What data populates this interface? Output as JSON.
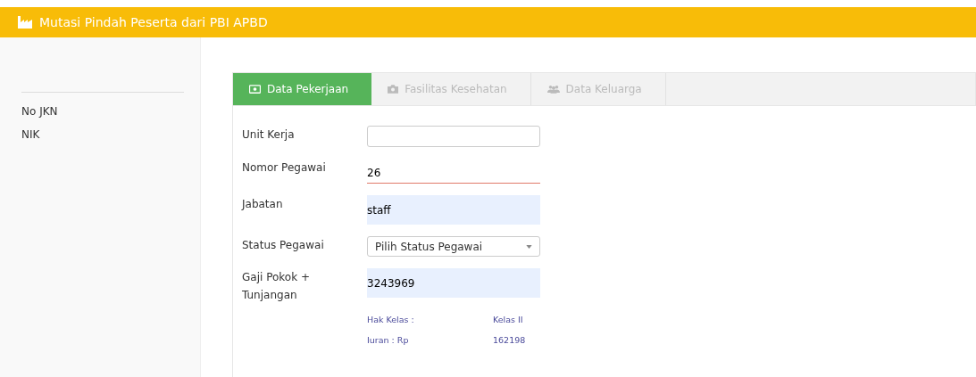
{
  "header": {
    "title": "Mutasi Pindah Peserta dari PBI APBD"
  },
  "sidebar": {
    "fields": [
      {
        "label": "No JKN"
      },
      {
        "label": "NIK"
      }
    ]
  },
  "steps": [
    {
      "label": "Data Pekerjaan",
      "selected": true
    },
    {
      "label": "Fasilitas Kesehatan",
      "selected": false
    },
    {
      "label": "Data Keluarga",
      "selected": false
    }
  ],
  "form": [
    {
      "label": "Unit Kerja",
      "kind": "input",
      "focused": false,
      "autofilled": false
    },
    {
      "label": "Nomor Pegawai",
      "kind": "input",
      "value": "26",
      "focused": true,
      "autofilled": false
    },
    {
      "label": "Jabatan",
      "kind": "input",
      "value": "staff",
      "focused": false,
      "autofilled": true
    },
    {
      "label": "Status Pegawai",
      "kind": "select",
      "value": "Pilih Status Pegawai"
    },
    {
      "label": "Gaji Pokok + Tunjangan",
      "kind": "input",
      "value": "3243969",
      "focused": false,
      "autofilled": true
    }
  ],
  "info": [
    {
      "label": "Hak Kelas :",
      "value": "Kelas II"
    },
    {
      "label": "Iuran : Rp",
      "value": "162198"
    }
  ]
}
